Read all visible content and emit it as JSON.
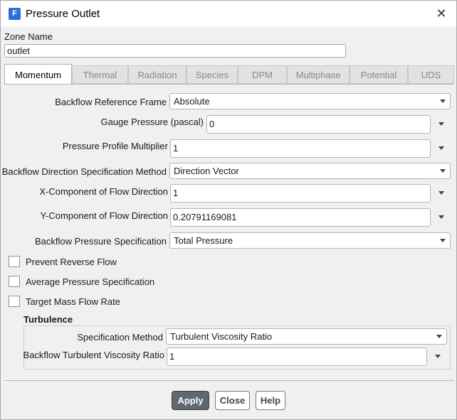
{
  "window": {
    "title": "Pressure Outlet",
    "app_icon_letter": "F"
  },
  "zone": {
    "label": "Zone Name",
    "value": "outlet"
  },
  "tabs": [
    {
      "label": "Momentum",
      "active": true
    },
    {
      "label": "Thermal"
    },
    {
      "label": "Radiation"
    },
    {
      "label": "Species"
    },
    {
      "label": "DPM"
    },
    {
      "label": "Multiphase"
    },
    {
      "label": "Potential"
    },
    {
      "label": "UDS"
    }
  ],
  "momentum": {
    "backflow_ref_frame": {
      "label": "Backflow Reference Frame",
      "value": "Absolute"
    },
    "gauge_pressure": {
      "label": "Gauge Pressure (pascal)",
      "value": "0"
    },
    "pressure_profile_multiplier": {
      "label": "Pressure Profile Multiplier",
      "value": "1"
    },
    "backflow_dir_method": {
      "label": "Backflow Direction Specification Method",
      "value": "Direction Vector"
    },
    "x_component": {
      "label": "X-Component of Flow Direction",
      "value": "1"
    },
    "y_component": {
      "label": "Y-Component of Flow Direction",
      "value": "0.20791169081"
    },
    "backflow_pressure_spec": {
      "label": "Backflow Pressure Specification",
      "value": "Total Pressure"
    },
    "checkboxes": {
      "prevent_reverse_flow": {
        "label": "Prevent Reverse Flow",
        "checked": false
      },
      "average_pressure": {
        "label": "Average Pressure Specification",
        "checked": false
      },
      "target_mass_flow": {
        "label": "Target Mass Flow Rate",
        "checked": false
      }
    }
  },
  "turbulence": {
    "title": "Turbulence",
    "spec_method": {
      "label": "Specification Method",
      "value": "Turbulent Viscosity Ratio"
    },
    "backflow_tvr": {
      "label": "Backflow Turbulent Viscosity Ratio",
      "value": "1"
    }
  },
  "buttons": {
    "apply": "Apply",
    "close": "Close",
    "help": "Help"
  },
  "colors": {
    "primary_button": "#5f6770",
    "app_icon": "#2b6fd6"
  }
}
